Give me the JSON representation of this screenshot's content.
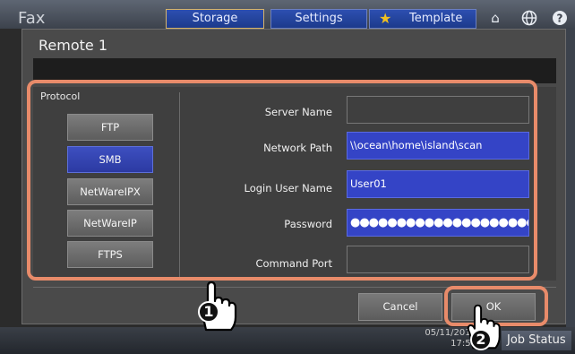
{
  "app": {
    "title": "Fax"
  },
  "tabs": [
    {
      "label": "Storage"
    },
    {
      "label": "Settings"
    },
    {
      "label": "Template"
    }
  ],
  "footer": {
    "datetime_line1": "05/11/2015",
    "datetime_line2": "17:50",
    "status_label": "Job Status"
  },
  "dialog": {
    "title": "Remote 1",
    "protocol": {
      "label": "Protocol",
      "options": [
        "FTP",
        "SMB",
        "NetWareIPX",
        "NetWareIP",
        "FTPS"
      ],
      "selected": "SMB"
    },
    "fields": {
      "server_name": {
        "label": "Server Name",
        "value": ""
      },
      "network_path": {
        "label": "Network Path",
        "value": "\\\\ocean\\home\\island\\scan"
      },
      "login_user_name": {
        "label": "Login User Name",
        "value": "User01"
      },
      "password": {
        "label": "Password",
        "value": "●●●●●●●●●●●●●●●●●●●●"
      },
      "command_port": {
        "label": "Command Port",
        "value": ""
      }
    },
    "buttons": {
      "cancel": "Cancel",
      "ok": "OK"
    }
  },
  "annotations": {
    "step1": "1",
    "step2": "2"
  },
  "colors": {
    "highlight": "#e88b6a",
    "selected": "#3444c6",
    "tab": "#2d4fb0"
  }
}
